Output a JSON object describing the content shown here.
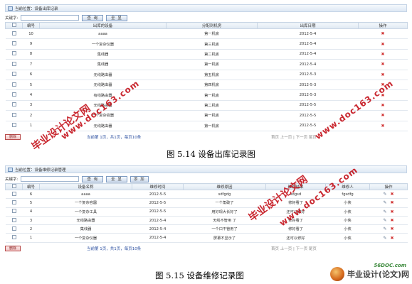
{
  "colors": {
    "delete": "#d03030",
    "watermark": "#c4111a",
    "header_border": "#c5d4e6"
  },
  "icons": {
    "delete": "close-icon",
    "edit": "pencil-icon",
    "panel": "window-icon"
  },
  "figure1": {
    "breadcrumb": "当前位置：设备出库记录",
    "keyword_label": "关键字:",
    "search_label": "查 询",
    "all_label": "全 显",
    "columns": [
      "编号",
      "出库的设备",
      "分配到机房",
      "出库日期",
      "操作"
    ],
    "rows": [
      {
        "id": "10",
        "device": "aaaa",
        "room": "第一机房",
        "date": "2012-5-4"
      },
      {
        "id": "9",
        "device": "一个复杂仪器",
        "room": "第三机房",
        "date": "2012-5-4"
      },
      {
        "id": "8",
        "device": "集线器",
        "room": "第二机房",
        "date": "2012-5-4"
      },
      {
        "id": "7",
        "device": "集线器",
        "room": "第一机房",
        "date": "2012-5-4"
      },
      {
        "id": "6",
        "device": "无线路由器",
        "room": "第五机房",
        "date": "2012-5-3"
      },
      {
        "id": "5",
        "device": "无线路由器",
        "room": "第四机房",
        "date": "2012-5-3"
      },
      {
        "id": "4",
        "device": "有线路由器",
        "room": "第一机房",
        "date": "2012-5-3"
      },
      {
        "id": "3",
        "device": "无线路由器",
        "room": "第二机房",
        "date": "2012-5-5"
      },
      {
        "id": "2",
        "device": "一个复杂容器",
        "room": "第一机房",
        "date": "2012-5-5"
      },
      {
        "id": "1",
        "device": "无线路由器",
        "room": "第一机房",
        "date": "2012-5-5"
      }
    ],
    "delete_label": "删除",
    "pager": "当前第 1页，共1页，每页10条",
    "nav": "首页 上一页 | 下一页 尾页",
    "caption": "图 5.14 设备出库记录图"
  },
  "figure2": {
    "breadcrumb": "当前位置：设备维修记录管理",
    "keyword_label": "关键字:",
    "search_label": "查 询",
    "all_label": "全 显",
    "add_label": "添 加",
    "columns": [
      "编号",
      "设备名称",
      "维修时间",
      "维修原因",
      "维修结果",
      "维修人",
      "操作"
    ],
    "rows": [
      {
        "id": "6",
        "device": "aaaa",
        "time": "2012-5-5",
        "reason": "sdfgdg",
        "result": "sdgsd",
        "person": "fgsdfg"
      },
      {
        "id": "5",
        "device": "一个复杂容器",
        "time": "2012-5-5",
        "reason": "一个角破了",
        "result": "修好看了",
        "person": "小侠"
      },
      {
        "id": "4",
        "device": "一个复杂工具",
        "time": "2012-5-5",
        "reason": "用好现大长好了",
        "result": "还可以修好",
        "person": "小侠"
      },
      {
        "id": "3",
        "device": "无线路由器",
        "time": "2012-5-4",
        "reason": "无线不管用 了",
        "result": "修好看了",
        "person": "小侠"
      },
      {
        "id": "2",
        "device": "集线器",
        "time": "2012-5-4",
        "reason": "一个口不管用了",
        "result": "修好看了",
        "person": "小侠"
      },
      {
        "id": "1",
        "device": "一个复杂仪器",
        "time": "2012-5-4",
        "reason": "屏幕不显示了",
        "result": "还可以修好",
        "person": "小侠"
      }
    ],
    "delete_label": "删除",
    "pager": "当前第 1页，共1页，每页10条",
    "nav": "首页 上一页 | 下一页 尾页",
    "caption": "图 5.15 设备维修记录图"
  },
  "watermark": {
    "main": "毕业设计论文网",
    "url": "www.doc163.com"
  },
  "brand": {
    "site": "56DOC.com",
    "name": "毕业设计(论文)网"
  }
}
